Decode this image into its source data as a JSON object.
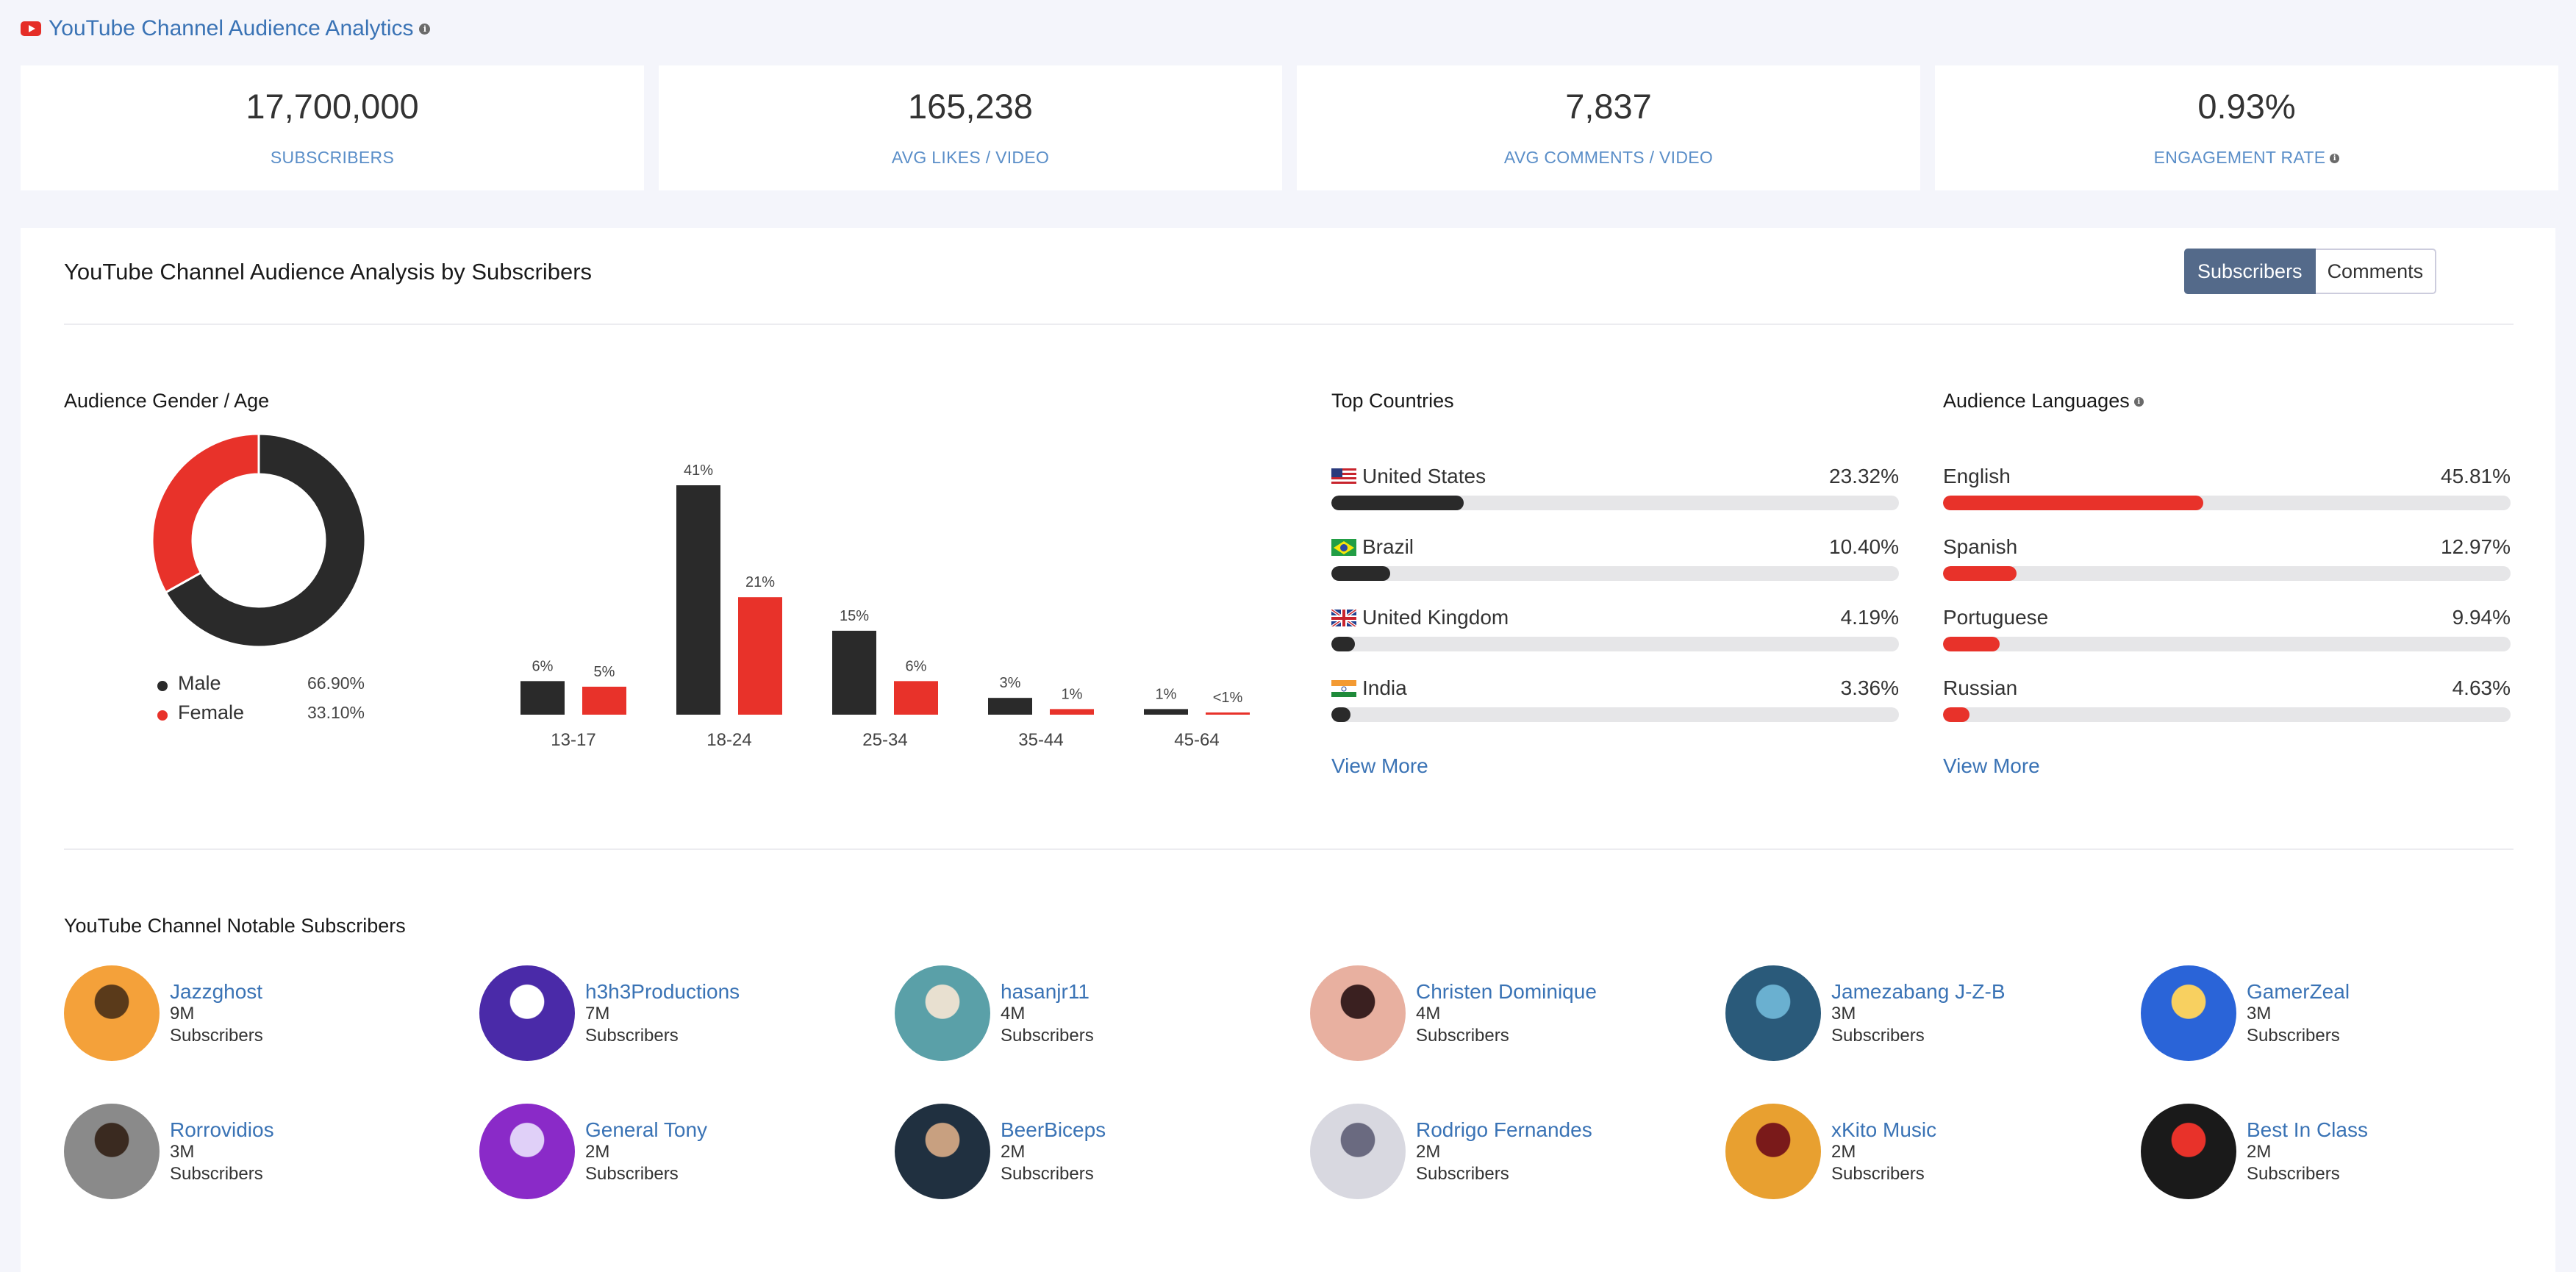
{
  "header": {
    "title": "YouTube Channel Audience Analytics"
  },
  "stats": [
    {
      "value": "17,700,000",
      "label": "SUBSCRIBERS"
    },
    {
      "value": "165,238",
      "label": "AVG LIKES / VIDEO"
    },
    {
      "value": "7,837",
      "label": "AVG COMMENTS / VIDEO"
    },
    {
      "value": "0.93%",
      "label": "ENGAGEMENT RATE"
    }
  ],
  "analysis": {
    "title": "YouTube Channel Audience Analysis by Subscribers",
    "toggle": [
      "Subscribers",
      "Comments"
    ],
    "active_toggle": "Subscribers"
  },
  "colors": {
    "male": "#2a2a2a",
    "female": "#e8322a",
    "accent": "#3a73b5",
    "track": "#e6e6e8"
  },
  "gender_age": {
    "title": "Audience Gender / Age",
    "gender": [
      {
        "label": "Male",
        "value": "66.90%",
        "percent": 66.9
      },
      {
        "label": "Female",
        "value": "33.10%",
        "percent": 33.1
      }
    ]
  },
  "chart_data": {
    "type": "bar",
    "categories": [
      "13-17",
      "18-24",
      "25-34",
      "35-44",
      "45-64"
    ],
    "series": [
      {
        "name": "Male",
        "values": [
          6,
          41,
          15,
          3,
          1
        ],
        "labels": [
          "6%",
          "41%",
          "15%",
          "3%",
          "1%"
        ]
      },
      {
        "name": "Female",
        "values": [
          5,
          21,
          6,
          1,
          0.3
        ],
        "labels": [
          "5%",
          "21%",
          "6%",
          "1%",
          "<1%"
        ]
      }
    ],
    "ylim": [
      0,
      41
    ]
  },
  "countries": {
    "title": "Top Countries",
    "items": [
      {
        "name": "United States",
        "value": "23.32%",
        "percent": 23.32
      },
      {
        "name": "Brazil",
        "value": "10.40%",
        "percent": 10.4
      },
      {
        "name": "United Kingdom",
        "value": "4.19%",
        "percent": 4.19
      },
      {
        "name": "India",
        "value": "3.36%",
        "percent": 3.36
      }
    ],
    "view_more": "View More"
  },
  "languages": {
    "title": "Audience Languages",
    "items": [
      {
        "name": "English",
        "value": "45.81%",
        "percent": 45.81
      },
      {
        "name": "Spanish",
        "value": "12.97%",
        "percent": 12.97
      },
      {
        "name": "Portuguese",
        "value": "9.94%",
        "percent": 9.94
      },
      {
        "name": "Russian",
        "value": "4.63%",
        "percent": 4.63
      }
    ],
    "view_more": "View More"
  },
  "notable": {
    "title": "YouTube Channel Notable Subscribers",
    "items": [
      {
        "name": "Jazzghost",
        "count": "9M",
        "label": "Subscribers"
      },
      {
        "name": "h3h3Productions",
        "count": "7M",
        "label": "Subscribers"
      },
      {
        "name": "hasanjr11",
        "count": "4M",
        "label": "Subscribers"
      },
      {
        "name": "Christen Dominique",
        "count": "4M",
        "label": "Subscribers"
      },
      {
        "name": "Jamezabang J-Z-B",
        "count": "3M",
        "label": "Subscribers"
      },
      {
        "name": "GamerZeal",
        "count": "3M",
        "label": "Subscribers"
      },
      {
        "name": "Rorrovidios",
        "count": "3M",
        "label": "Subscribers"
      },
      {
        "name": "General Tony",
        "count": "2M",
        "label": "Subscribers"
      },
      {
        "name": "BeerBiceps",
        "count": "2M",
        "label": "Subscribers"
      },
      {
        "name": "Rodrigo Fernandes",
        "count": "2M",
        "label": "Subscribers"
      },
      {
        "name": "xKito Music",
        "count": "2M",
        "label": "Subscribers"
      },
      {
        "name": "Best In Class",
        "count": "2M",
        "label": "Subscribers"
      }
    ]
  }
}
